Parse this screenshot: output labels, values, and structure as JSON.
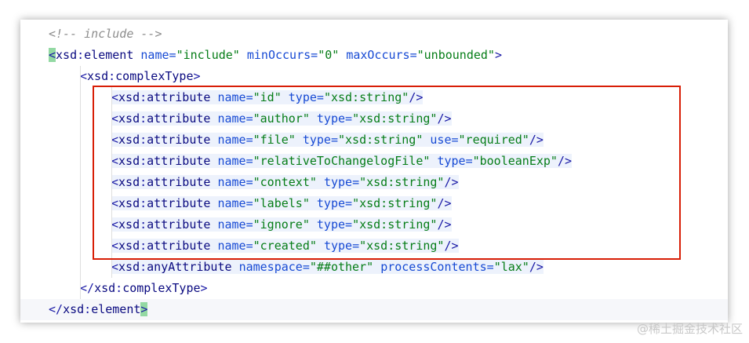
{
  "editor": {
    "lines": [
      {
        "indent": 1,
        "comment": "<!-- include -->"
      },
      {
        "indent": 1,
        "tag": "xsd:element",
        "attrs": [
          [
            "name",
            "include"
          ],
          [
            "minOccurs",
            "0"
          ],
          [
            "maxOccurs",
            "unbounded"
          ]
        ],
        "close": ">",
        "bracket_highlight": true
      },
      {
        "indent": 2,
        "tag": "xsd:complexType",
        "attrs": [],
        "close": ">"
      },
      {
        "indent": 3,
        "tag": "xsd:attribute",
        "attrs": [
          [
            "name",
            "id"
          ],
          [
            "type",
            "xsd:string"
          ]
        ],
        "close": "/>",
        "highlight": true
      },
      {
        "indent": 3,
        "tag": "xsd:attribute",
        "attrs": [
          [
            "name",
            "author"
          ],
          [
            "type",
            "xsd:string"
          ]
        ],
        "close": "/>",
        "highlight": true
      },
      {
        "indent": 3,
        "tag": "xsd:attribute",
        "attrs": [
          [
            "name",
            "file"
          ],
          [
            "type",
            "xsd:string"
          ],
          [
            "use",
            "required"
          ]
        ],
        "close": "/>",
        "highlight": true
      },
      {
        "indent": 3,
        "tag": "xsd:attribute",
        "attrs": [
          [
            "name",
            "relativeToChangelogFile"
          ],
          [
            "type",
            "booleanExp"
          ]
        ],
        "close": "/>",
        "highlight": true
      },
      {
        "indent": 3,
        "tag": "xsd:attribute",
        "attrs": [
          [
            "name",
            "context"
          ],
          [
            "type",
            "xsd:string"
          ]
        ],
        "close": "/>",
        "highlight": true
      },
      {
        "indent": 3,
        "tag": "xsd:attribute",
        "attrs": [
          [
            "name",
            "labels"
          ],
          [
            "type",
            "xsd:string"
          ]
        ],
        "close": "/>",
        "highlight": true
      },
      {
        "indent": 3,
        "tag": "xsd:attribute",
        "attrs": [
          [
            "name",
            "ignore"
          ],
          [
            "type",
            "xsd:string"
          ]
        ],
        "close": "/>",
        "highlight": true
      },
      {
        "indent": 3,
        "tag": "xsd:attribute",
        "attrs": [
          [
            "name",
            "created"
          ],
          [
            "type",
            "xsd:string"
          ]
        ],
        "close": "/>",
        "highlight": true
      },
      {
        "indent": 3,
        "tag": "xsd:anyAttribute",
        "attrs": [
          [
            "namespace",
            "##other"
          ],
          [
            "processContents",
            "lax"
          ]
        ],
        "close": "/>",
        "highlight": true
      },
      {
        "indent": 2,
        "closing_tag": "xsd:complexType"
      },
      {
        "indent": 1,
        "closing_tag": "xsd:element",
        "bracket_highlight": true,
        "current_line": true
      }
    ]
  },
  "watermark": "@稀土掘金技术社区",
  "colors": {
    "selection_border": "#d81e06",
    "bracket_highlight": "#93d9a3"
  }
}
